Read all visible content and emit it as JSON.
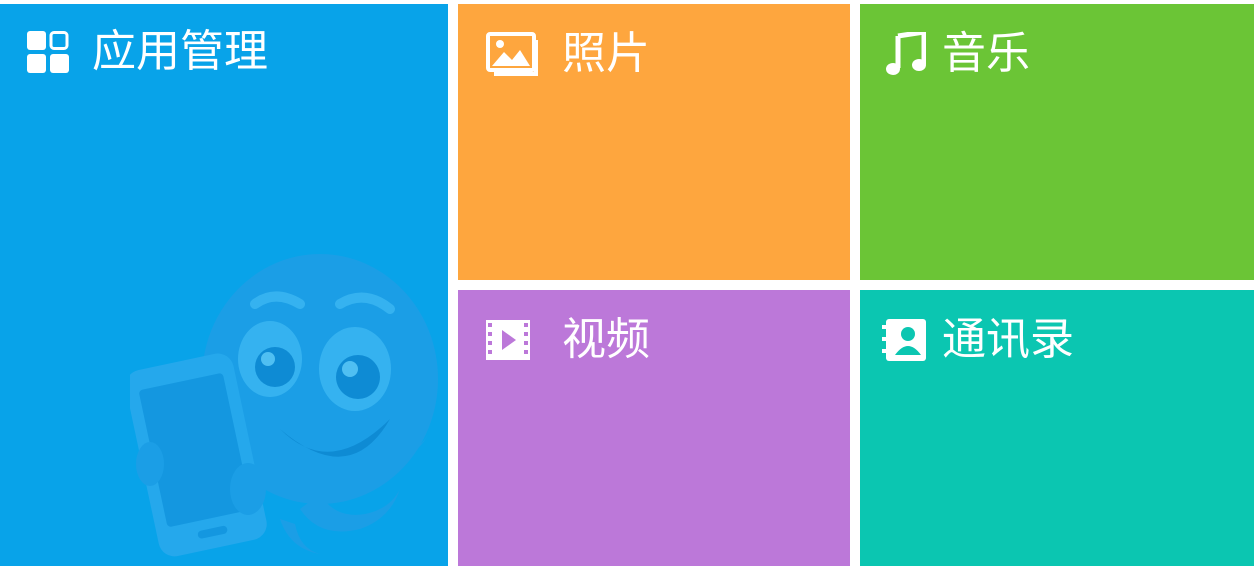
{
  "tiles": {
    "apps": {
      "label": "应用管理",
      "icon": "grid-icon",
      "color": "#08A3E9"
    },
    "photos": {
      "label": "照片",
      "icon": "image-icon",
      "color": "#FEA63E"
    },
    "music": {
      "label": "音乐",
      "icon": "music-note-icon",
      "color": "#6BC536"
    },
    "video": {
      "label": "视频",
      "icon": "film-play-icon",
      "color": "#BC78D9"
    },
    "contacts": {
      "label": "通讯录",
      "icon": "contact-card-icon",
      "color": "#0BC6B1"
    }
  },
  "mascot": {
    "name": "octopus-mascot-illustration"
  }
}
